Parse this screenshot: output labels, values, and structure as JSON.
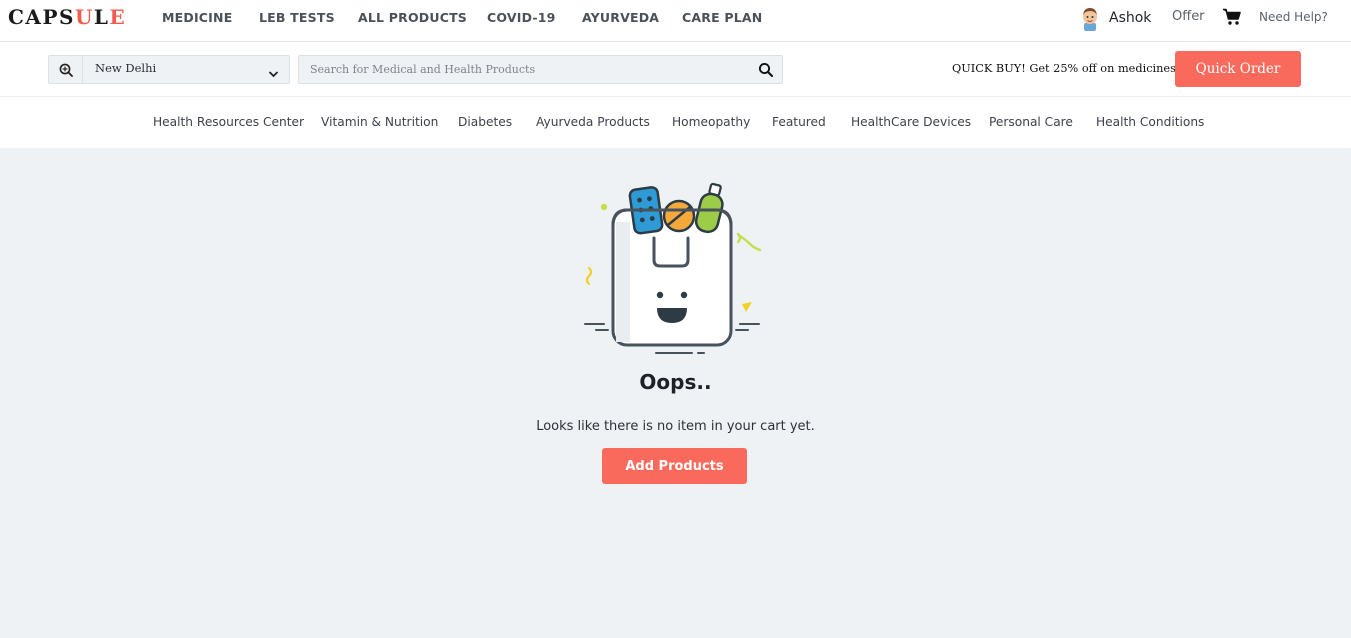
{
  "brand": {
    "letters": [
      {
        "ch": "C",
        "color": "#1a1a1a"
      },
      {
        "ch": "A",
        "color": "#1a1a1a"
      },
      {
        "ch": "P",
        "color": "#1a1a1a"
      },
      {
        "ch": "S",
        "color": "#1a1a1a"
      },
      {
        "ch": "U",
        "color": "#f25c4c"
      },
      {
        "ch": "L",
        "color": "#1a1a1a"
      },
      {
        "ch": "E",
        "color": "#f25c4c"
      }
    ]
  },
  "nav": {
    "items": [
      "MEDICINE",
      "LEB TESTS",
      "ALL PRODUCTS",
      "COVID-19",
      "AYURVEDA",
      "CARE PLAN"
    ]
  },
  "user": {
    "name": "Ashok",
    "offer_label": "Offer",
    "cart_icon": "shopping-cart-icon",
    "help_label": "Need Help?"
  },
  "location": {
    "icon": "locate-zoom-icon",
    "city": "New Delhi"
  },
  "search": {
    "placeholder": "Search for Medical and Health Products",
    "value": ""
  },
  "promo": {
    "text": "QUICK BUY! Get 25% off on medicines*",
    "button_label": "Quick Order"
  },
  "categories": [
    "Health Resources Center",
    "Vitamin & Nutrition",
    "Diabetes",
    "Ayurveda Products",
    "Homeopathy",
    "Featured",
    "HealthCare Devices",
    "Personal Care",
    "Health Conditions"
  ],
  "empty_cart": {
    "title": "Oops..",
    "message": "Looks like there is no item in your cart yet.",
    "button_label": "Add Products"
  },
  "colors": {
    "accent": "#f96a5c",
    "page_background": "#eff2f5"
  }
}
